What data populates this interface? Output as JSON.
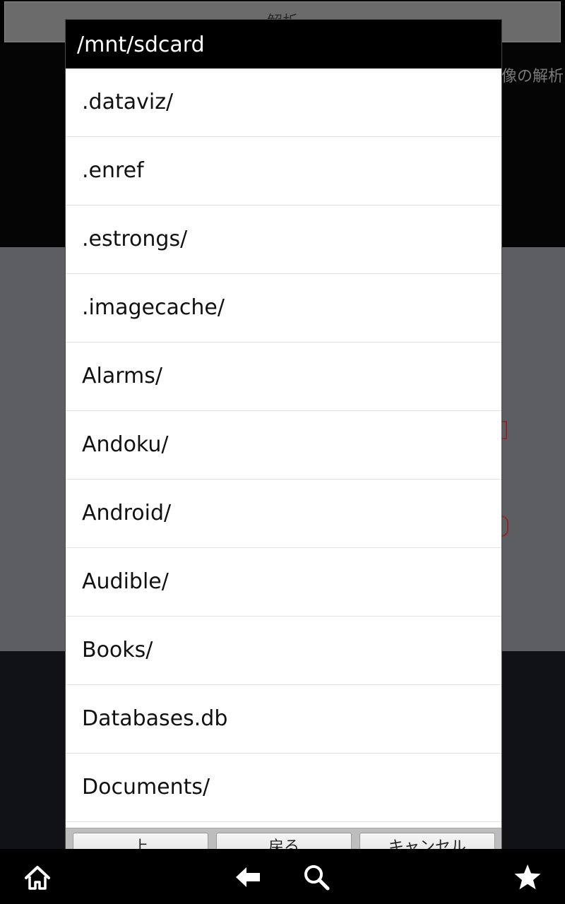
{
  "background_app": {
    "top_bar_text": "解析",
    "header_right_text": "像の解析"
  },
  "dialog": {
    "title": "/mnt/sdcard",
    "files": [
      ".dataviz/",
      ".enref",
      ".estrongs/",
      ".imagecache/",
      "Alarms/",
      "Andoku/",
      "Android/",
      "Audible/",
      "Books/",
      "Databases.db",
      "Documents/"
    ],
    "buttons": [
      "上",
      "戻る",
      "キャンセル"
    ]
  },
  "navbar": {
    "icons": [
      "home-icon",
      "back-icon",
      "search-icon",
      "star-icon"
    ]
  }
}
